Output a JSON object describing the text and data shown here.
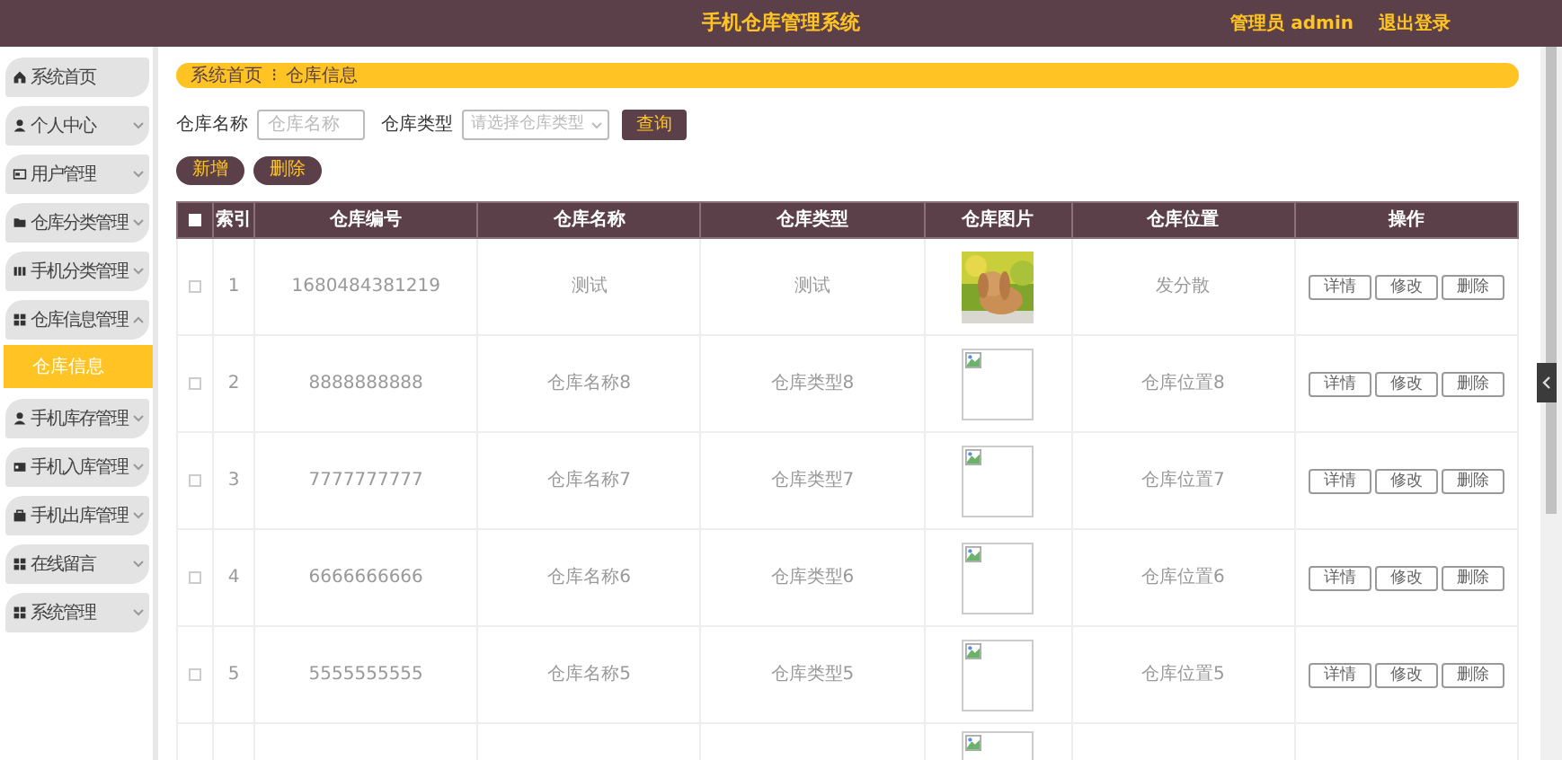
{
  "header": {
    "title": "手机仓库管理系统",
    "user": "管理员 admin",
    "logout": "退出登录"
  },
  "sidebar": {
    "items": [
      {
        "label": "系统首页",
        "kind": "link"
      },
      {
        "label": "个人中心",
        "kind": "menu",
        "expanded": false
      },
      {
        "label": "用户管理",
        "kind": "menu",
        "expanded": false
      },
      {
        "label": "仓库分类管理",
        "kind": "menu",
        "expanded": false
      },
      {
        "label": "手机分类管理",
        "kind": "menu",
        "expanded": false
      },
      {
        "label": "仓库信息管理",
        "kind": "menu",
        "expanded": true,
        "children": [
          {
            "label": "仓库信息",
            "selected": true
          }
        ]
      },
      {
        "label": "手机库存管理",
        "kind": "menu",
        "expanded": false
      },
      {
        "label": "手机入库管理",
        "kind": "menu",
        "expanded": false
      },
      {
        "label": "手机出库管理",
        "kind": "menu",
        "expanded": false
      },
      {
        "label": "在线留言",
        "kind": "menu",
        "expanded": false
      },
      {
        "label": "系统管理",
        "kind": "menu",
        "expanded": false
      }
    ]
  },
  "breadcrumb": {
    "items": [
      "系统首页",
      "仓库信息"
    ],
    "separator": "⁝"
  },
  "search": {
    "fields": [
      {
        "label": "仓库名称",
        "placeholder": "仓库名称",
        "kind": "text"
      },
      {
        "label": "仓库类型",
        "placeholder": "请选择仓库类型",
        "kind": "select"
      }
    ],
    "button": "查询"
  },
  "actions": [
    "新增",
    "删除"
  ],
  "table": {
    "columns": [
      "索引",
      "仓库编号",
      "仓库名称",
      "仓库类型",
      "仓库图片",
      "仓库位置",
      "操作"
    ],
    "rows": [
      {
        "checked": false,
        "index": "1",
        "code": "1680484381219",
        "name": "测试",
        "type": "测试",
        "location": "发分散",
        "actions": [
          "详情",
          "修改",
          "删除"
        ]
      },
      {
        "checked": false,
        "index": "2",
        "code": "8888888888",
        "name": "仓库名称8",
        "type": "仓库类型8",
        "image": {
          "kind": "broken"
        },
        "location": "仓库位置8",
        "actions": [
          "详情",
          "修改",
          "删除"
        ]
      },
      {
        "checked": false,
        "index": "3",
        "code": "7777777777",
        "name": "仓库名称7",
        "type": "仓库类型7",
        "image": {
          "kind": "broken"
        },
        "location": "仓库位置7",
        "actions": [
          "详情",
          "修改",
          "删除"
        ]
      },
      {
        "checked": false,
        "index": "4",
        "code": "6666666666",
        "name": "仓库名称6",
        "type": "仓库类型6",
        "image": {
          "kind": "broken"
        },
        "location": "仓库位置6",
        "actions": [
          "详情",
          "修改",
          "删除"
        ]
      },
      {
        "checked": false,
        "index": "5",
        "code": "5555555555",
        "name": "仓库名称5",
        "type": "仓库类型5",
        "image": {
          "kind": "broken"
        },
        "location": "仓库位置5",
        "actions": [
          "详情",
          "修改",
          "删除"
        ]
      },
      {
        "image": {
          "kind": "broken"
        }
      }
    ],
    "select_all_checked": false
  }
}
